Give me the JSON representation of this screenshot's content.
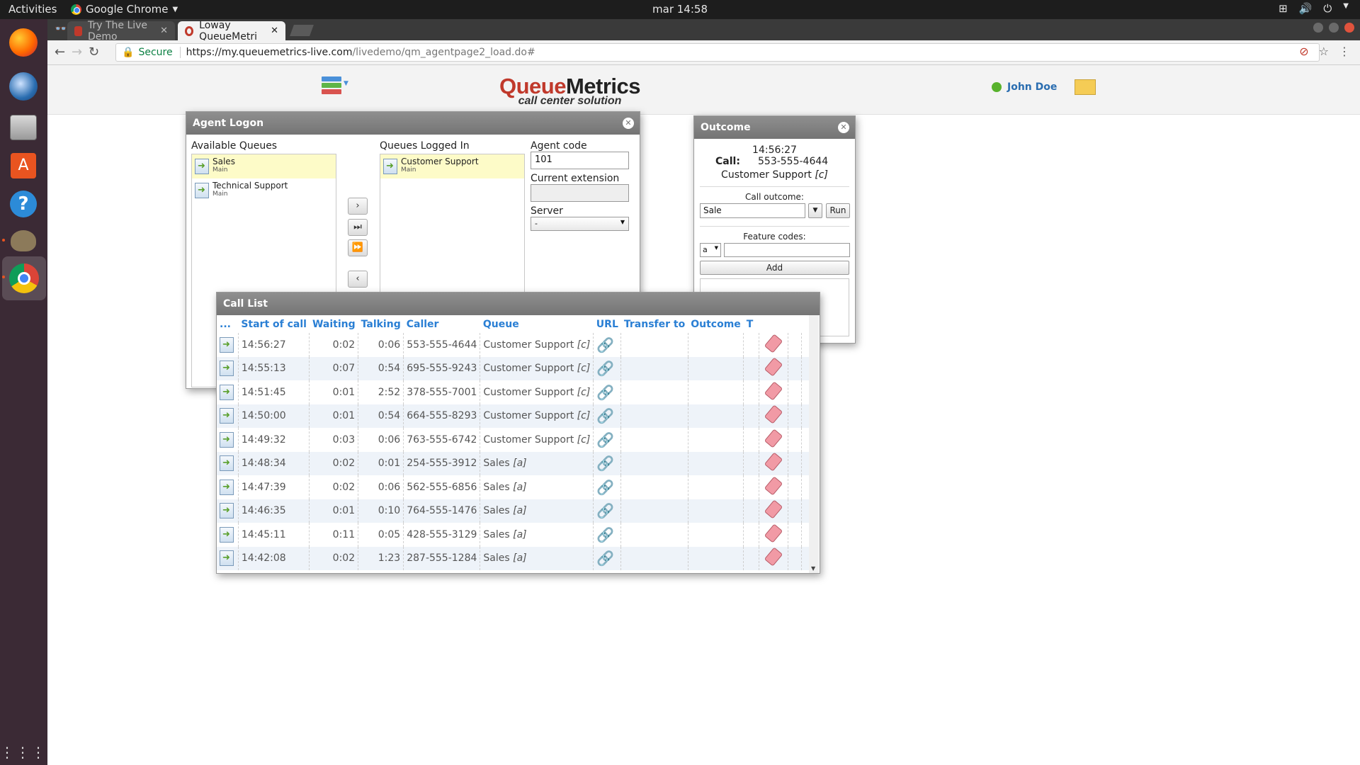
{
  "topbar": {
    "activities": "Activities",
    "app_name": "Google Chrome",
    "clock": "mar 14:58"
  },
  "browser": {
    "tabs": [
      {
        "label": "Try The Live Demo",
        "active": false
      },
      {
        "label": "Loway QueueMetri",
        "active": true
      }
    ],
    "secure_label": "Secure",
    "url_host": "https://my.queuemetrics-live.com",
    "url_path": "/livedemo/qm_agentpage2_load.do#"
  },
  "app": {
    "logo_brand_red": "Queue",
    "logo_brand_dark": "Metrics",
    "logo_tagline": "call center solution",
    "user_name": "John Doe"
  },
  "agent_logon": {
    "title": "Agent Logon",
    "available_label": "Available Queues",
    "available_queues": [
      {
        "name": "Sales",
        "sub": "Main",
        "highlighted": true
      },
      {
        "name": "Technical Support",
        "sub": "Main",
        "highlighted": false
      }
    ],
    "logged_label": "Queues Logged In",
    "logged_queues": [
      {
        "name": "Customer Support",
        "sub": "Main",
        "highlighted": true
      }
    ],
    "agent_code_label": "Agent code",
    "agent_code_value": "101",
    "extension_label": "Current extension",
    "extension_value": "",
    "server_label": "Server",
    "server_value": "-"
  },
  "outcome": {
    "title": "Outcome",
    "time": "14:56:27",
    "call_label": "Call:",
    "call_number": "553-555-4644",
    "call_queue": "Customer Support",
    "call_queue_tag": "[c]",
    "call_outcome_label": "Call outcome:",
    "call_outcome_value": "Sale",
    "run_label": "Run",
    "feature_codes_label": "Feature codes:",
    "feature_select_value": "a",
    "feature_input_value": "",
    "add_label": "Add"
  },
  "call_list": {
    "title": "Call List",
    "columns": [
      "...",
      "Start of call",
      "Waiting",
      "Talking",
      "Caller",
      "Queue",
      "URL",
      "Transfer to",
      "Outcome",
      "T"
    ],
    "rows": [
      {
        "start": "14:56:27",
        "waiting": "0:02",
        "talking": "0:06",
        "caller": "553-555-4644",
        "queue": "Customer Support",
        "tag": "[c]"
      },
      {
        "start": "14:55:13",
        "waiting": "0:07",
        "talking": "0:54",
        "caller": "695-555-9243",
        "queue": "Customer Support",
        "tag": "[c]"
      },
      {
        "start": "14:51:45",
        "waiting": "0:01",
        "talking": "2:52",
        "caller": "378-555-7001",
        "queue": "Customer Support",
        "tag": "[c]"
      },
      {
        "start": "14:50:00",
        "waiting": "0:01",
        "talking": "0:54",
        "caller": "664-555-8293",
        "queue": "Customer Support",
        "tag": "[c]"
      },
      {
        "start": "14:49:32",
        "waiting": "0:03",
        "talking": "0:06",
        "caller": "763-555-6742",
        "queue": "Customer Support",
        "tag": "[c]"
      },
      {
        "start": "14:48:34",
        "waiting": "0:02",
        "talking": "0:01",
        "caller": "254-555-3912",
        "queue": "Sales",
        "tag": "[a]"
      },
      {
        "start": "14:47:39",
        "waiting": "0:02",
        "talking": "0:06",
        "caller": "562-555-6856",
        "queue": "Sales",
        "tag": "[a]"
      },
      {
        "start": "14:46:35",
        "waiting": "0:01",
        "talking": "0:10",
        "caller": "764-555-1476",
        "queue": "Sales",
        "tag": "[a]"
      },
      {
        "start": "14:45:11",
        "waiting": "0:11",
        "talking": "0:05",
        "caller": "428-555-3129",
        "queue": "Sales",
        "tag": "[a]"
      },
      {
        "start": "14:42:08",
        "waiting": "0:02",
        "talking": "1:23",
        "caller": "287-555-1284",
        "queue": "Sales",
        "tag": "[a]"
      }
    ]
  },
  "colors": {
    "accent_blue": "#2a7fd4",
    "brand_red": "#c0392b",
    "dialog_title": "#7f7f7f",
    "dock": "#3b2a35"
  }
}
